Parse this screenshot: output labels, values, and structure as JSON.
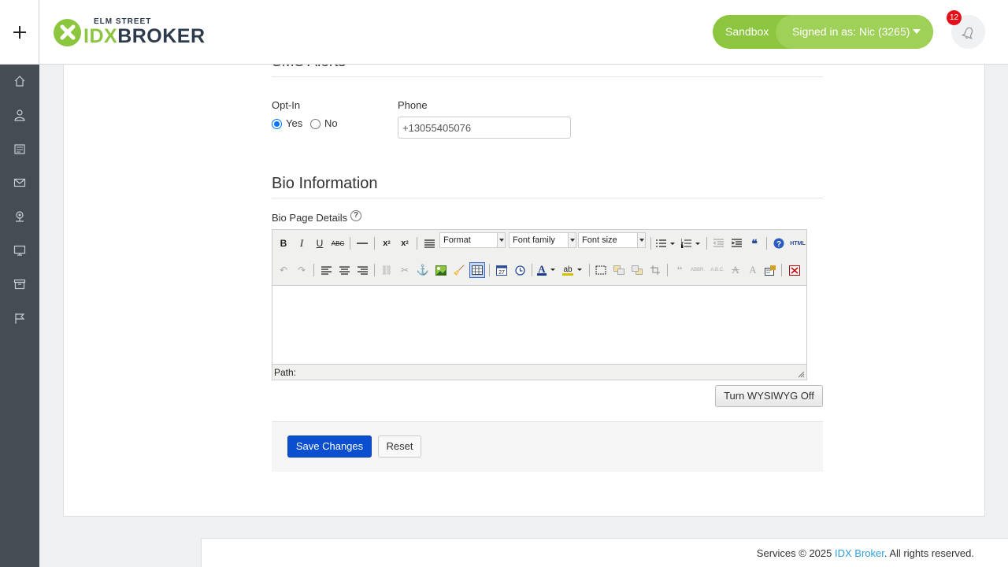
{
  "header": {
    "logo_small": "ELM STREET",
    "logo_idx": "IDX",
    "logo_broker": "BROKER",
    "sandbox_label": "Sandbox",
    "signed_in_label": "Signed in as: Nic (3265)",
    "notification_count": "12"
  },
  "sidebar": {
    "items": [
      {
        "icon": "home-icon"
      },
      {
        "icon": "user-icon"
      },
      {
        "icon": "listings-icon"
      },
      {
        "icon": "mail-icon"
      },
      {
        "icon": "map-pin-icon"
      },
      {
        "icon": "monitor-icon"
      },
      {
        "icon": "archive-icon"
      },
      {
        "icon": "flag-icon"
      }
    ]
  },
  "sms": {
    "section_title": "SMS Alerts",
    "opt_in_label": "Opt-In",
    "yes_label": "Yes",
    "no_label": "No",
    "selected": "Yes",
    "phone_label": "Phone",
    "phone_value": "+13055405076"
  },
  "bio": {
    "section_title": "Bio Information",
    "page_details_label": "Bio Page Details",
    "help_glyph": "?",
    "editor": {
      "format_label": "Format",
      "font_family_label": "Font family",
      "font_size_label": "Font size",
      "html_label": "HTML",
      "path_label": "Path:"
    },
    "wysiwyg_button": "Turn WYSIWYG Off"
  },
  "actions": {
    "save_label": "Save Changes",
    "reset_label": "Reset"
  },
  "footer": {
    "prefix": "Services © 2025 ",
    "link_text": "IDX Broker",
    "suffix": ". All rights reserved."
  },
  "colors": {
    "brand_green": "#8cc63f",
    "sidebar_bg": "#454c53",
    "primary_button": "#0a4fcf",
    "badge_red": "#e3101a",
    "link_blue": "#2d9fd9"
  }
}
